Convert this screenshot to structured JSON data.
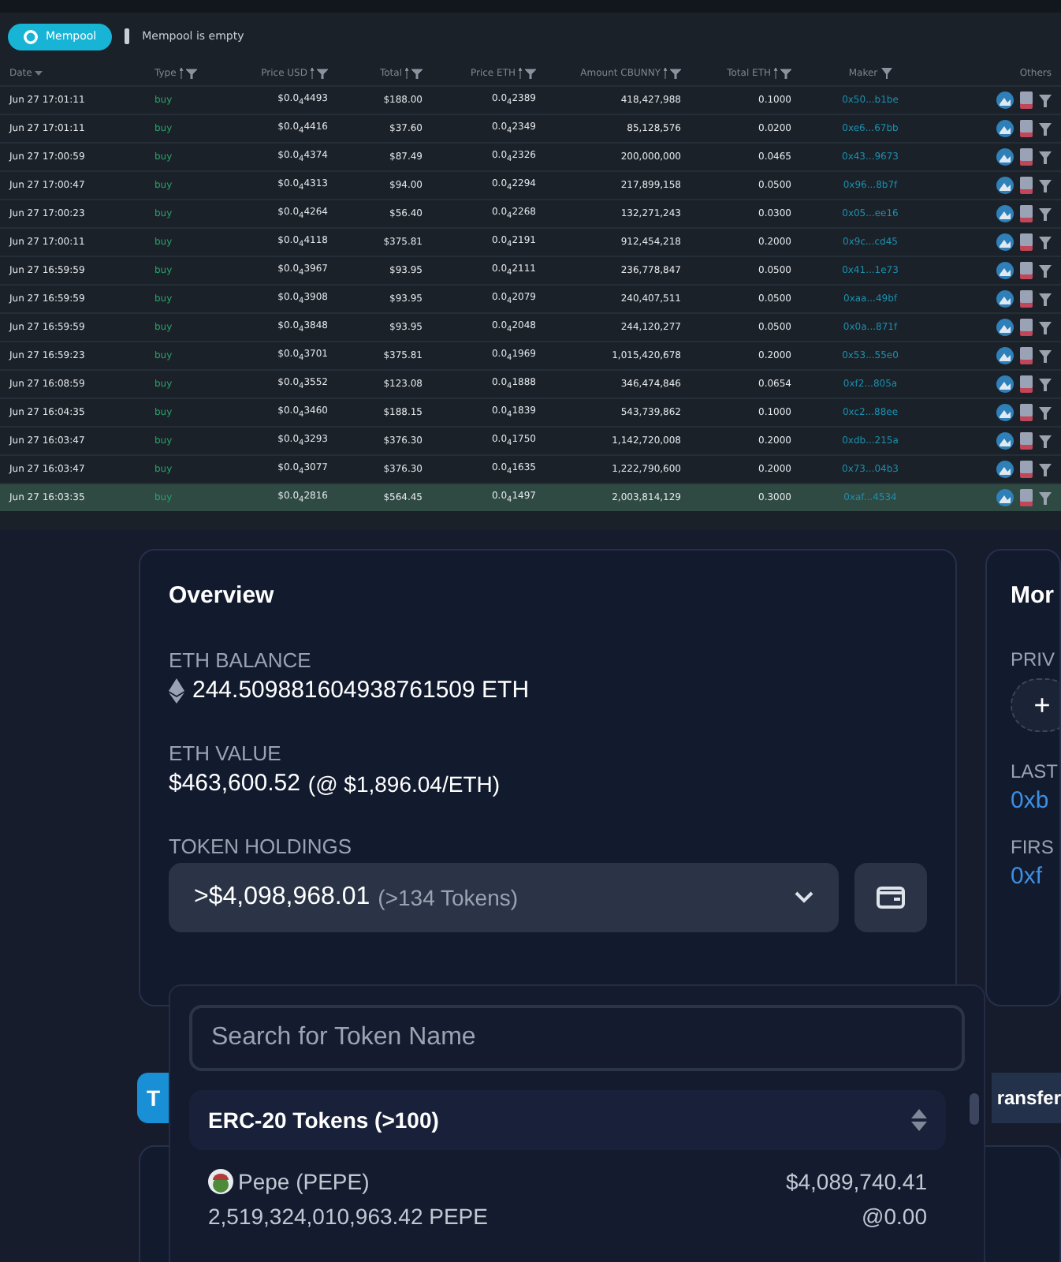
{
  "mempool": {
    "button": "Mempool",
    "status": "Mempool is empty"
  },
  "table": {
    "columns": [
      {
        "label": "Date",
        "kind": "sort"
      },
      {
        "label": "Type",
        "kind": "filter"
      },
      {
        "label": "Price USD",
        "kind": "filter"
      },
      {
        "label": "Total",
        "kind": "filter"
      },
      {
        "label": "Price ETH",
        "kind": "filter"
      },
      {
        "label": "Amount CBUNNY",
        "kind": "filter"
      },
      {
        "label": "Total ETH",
        "kind": "filter"
      },
      {
        "label": "Maker",
        "kind": "funnel"
      },
      {
        "label": "Others",
        "kind": "plain"
      }
    ],
    "rows": [
      {
        "date": "Jun 27 17:01:11",
        "type": "buy",
        "price_usd": "$0.0$_{4}$4493",
        "total": "$188.00",
        "price_eth": "0.0$_{4}$2389",
        "amount": "418,427,988",
        "total_eth": "0.1000",
        "maker": "0x50...b1be",
        "selected": false
      },
      {
        "date": "Jun 27 17:01:11",
        "type": "buy",
        "price_usd": "$0.0$_{4}$4416",
        "total": "$37.60",
        "price_eth": "0.0$_{4}$2349",
        "amount": "85,128,576",
        "total_eth": "0.0200",
        "maker": "0xe6...67bb",
        "selected": false
      },
      {
        "date": "Jun 27 17:00:59",
        "type": "buy",
        "price_usd": "$0.0$_{4}$4374",
        "total": "$87.49",
        "price_eth": "0.0$_{4}$2326",
        "amount": "200,000,000",
        "total_eth": "0.0465",
        "maker": "0x43...9673",
        "selected": false
      },
      {
        "date": "Jun 27 17:00:47",
        "type": "buy",
        "price_usd": "$0.0$_{4}$4313",
        "total": "$94.00",
        "price_eth": "0.0$_{4}$2294",
        "amount": "217,899,158",
        "total_eth": "0.0500",
        "maker": "0x96...8b7f",
        "selected": false
      },
      {
        "date": "Jun 27 17:00:23",
        "type": "buy",
        "price_usd": "$0.0$_{4}$4264",
        "total": "$56.40",
        "price_eth": "0.0$_{4}$2268",
        "amount": "132,271,243",
        "total_eth": "0.0300",
        "maker": "0x05...ee16",
        "selected": false
      },
      {
        "date": "Jun 27 17:00:11",
        "type": "buy",
        "price_usd": "$0.0$_{4}$4118",
        "total": "$375.81",
        "price_eth": "0.0$_{4}$2191",
        "amount": "912,454,218",
        "total_eth": "0.2000",
        "maker": "0x9c...cd45",
        "selected": false
      },
      {
        "date": "Jun 27 16:59:59",
        "type": "buy",
        "price_usd": "$0.0$_{4}$3967",
        "total": "$93.95",
        "price_eth": "0.0$_{4}$2111",
        "amount": "236,778,847",
        "total_eth": "0.0500",
        "maker": "0x41...1e73",
        "selected": false
      },
      {
        "date": "Jun 27 16:59:59",
        "type": "buy",
        "price_usd": "$0.0$_{4}$3908",
        "total": "$93.95",
        "price_eth": "0.0$_{4}$2079",
        "amount": "240,407,511",
        "total_eth": "0.0500",
        "maker": "0xaa...49bf",
        "selected": false
      },
      {
        "date": "Jun 27 16:59:59",
        "type": "buy",
        "price_usd": "$0.0$_{4}$3848",
        "total": "$93.95",
        "price_eth": "0.0$_{4}$2048",
        "amount": "244,120,277",
        "total_eth": "0.0500",
        "maker": "0x0a...871f",
        "selected": false
      },
      {
        "date": "Jun 27 16:59:23",
        "type": "buy",
        "price_usd": "$0.0$_{4}$3701",
        "total": "$375.81",
        "price_eth": "0.0$_{4}$1969",
        "amount": "1,015,420,678",
        "total_eth": "0.2000",
        "maker": "0x53...55e0",
        "selected": false
      },
      {
        "date": "Jun 27 16:08:59",
        "type": "buy",
        "price_usd": "$0.0$_{4}$3552",
        "total": "$123.08",
        "price_eth": "0.0$_{4}$1888",
        "amount": "346,474,846",
        "total_eth": "0.0654",
        "maker": "0xf2...805a",
        "selected": false
      },
      {
        "date": "Jun 27 16:04:35",
        "type": "buy",
        "price_usd": "$0.0$_{4}$3460",
        "total": "$188.15",
        "price_eth": "0.0$_{4}$1839",
        "amount": "543,739,862",
        "total_eth": "0.1000",
        "maker": "0xc2...88ee",
        "selected": false
      },
      {
        "date": "Jun 27 16:03:47",
        "type": "buy",
        "price_usd": "$0.0$_{4}$3293",
        "total": "$376.30",
        "price_eth": "0.0$_{4}$1750",
        "amount": "1,142,720,008",
        "total_eth": "0.2000",
        "maker": "0xdb...215a",
        "selected": false
      },
      {
        "date": "Jun 27 16:03:47",
        "type": "buy",
        "price_usd": "$0.0$_{4}$3077",
        "total": "$376.30",
        "price_eth": "0.0$_{4}$1635",
        "amount": "1,222,790,600",
        "total_eth": "0.2000",
        "maker": "0x73...04b3",
        "selected": false
      },
      {
        "date": "Jun 27 16:03:35",
        "type": "buy",
        "price_usd": "$0.0$_{4}$2816",
        "total": "$564.45",
        "price_eth": "0.0$_{4}$1497",
        "amount": "2,003,814,129",
        "total_eth": "0.3000",
        "maker": "0xaf...4534",
        "selected": true
      }
    ]
  },
  "overview": {
    "title": "Overview",
    "eth_balance_label": "ETH BALANCE",
    "eth_balance": "244.509881604938761509 ETH",
    "eth_value_label": "ETH VALUE",
    "eth_value": "$463,600.52",
    "eth_rate": "(@ $1,896.04/ETH)",
    "token_holdings_label": "TOKEN HOLDINGS",
    "token_total": ">$4,098,968.01",
    "token_count": "(>134 Tokens)"
  },
  "more_card": {
    "title": "Mor",
    "private_label": "PRIV",
    "plus": "+",
    "last_label": "LAST",
    "last_value": "0xb",
    "first_label": "FIRS",
    "first_value": "0xf"
  },
  "tabs": [
    {
      "label": "T",
      "selected": true
    },
    {
      "label": "ransfer",
      "selected": false
    }
  ],
  "token_dropdown": {
    "placeholder": "Search for Token Name",
    "group": "ERC-20 Tokens (>100)",
    "tokens": [
      {
        "name": "Pepe (PEPE)",
        "balance": "2,519,324,010,963.42 PEPE",
        "value": "$4,089,740.41",
        "rate": "@0.00"
      }
    ]
  }
}
